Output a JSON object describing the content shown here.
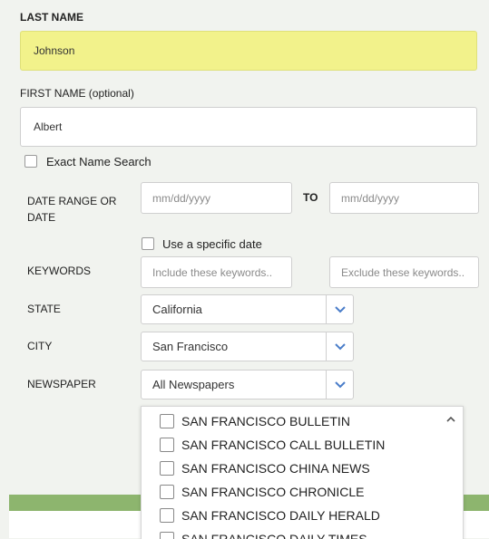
{
  "last_name": {
    "label": "LAST NAME",
    "value": "Johnson"
  },
  "first_name": {
    "label": "FIRST NAME (optional)",
    "value": "Albert"
  },
  "exact_search": {
    "label": "Exact Name Search"
  },
  "date_range": {
    "label": "DATE RANGE OR DATE",
    "from_placeholder": "mm/dd/yyyy",
    "to_label": "TO",
    "to_placeholder": "mm/dd/yyyy",
    "specific_date_label": "Use a specific date"
  },
  "keywords": {
    "label": "KEYWORDS",
    "include_placeholder": "Include these keywords..",
    "exclude_placeholder": "Exclude these keywords.."
  },
  "state": {
    "label": "STATE",
    "value": "California"
  },
  "city": {
    "label": "CITY",
    "value": "San Francisco"
  },
  "newspaper": {
    "label": "NEWSPAPER",
    "value": "All Newspapers",
    "options": [
      "SAN FRANCISCO BULLETIN",
      "SAN FRANCISCO CALL BULLETIN",
      "SAN FRANCISCO CHINA NEWS",
      "SAN FRANCISCO CHRONICLE",
      "SAN FRANCISCO DAILY HERALD",
      "SAN FRANCISCO DAILY TIMES"
    ]
  },
  "colors": {
    "highlight": "#f2f28b",
    "accent_bar": "#8db56e",
    "chevron": "#4a7dc9"
  }
}
